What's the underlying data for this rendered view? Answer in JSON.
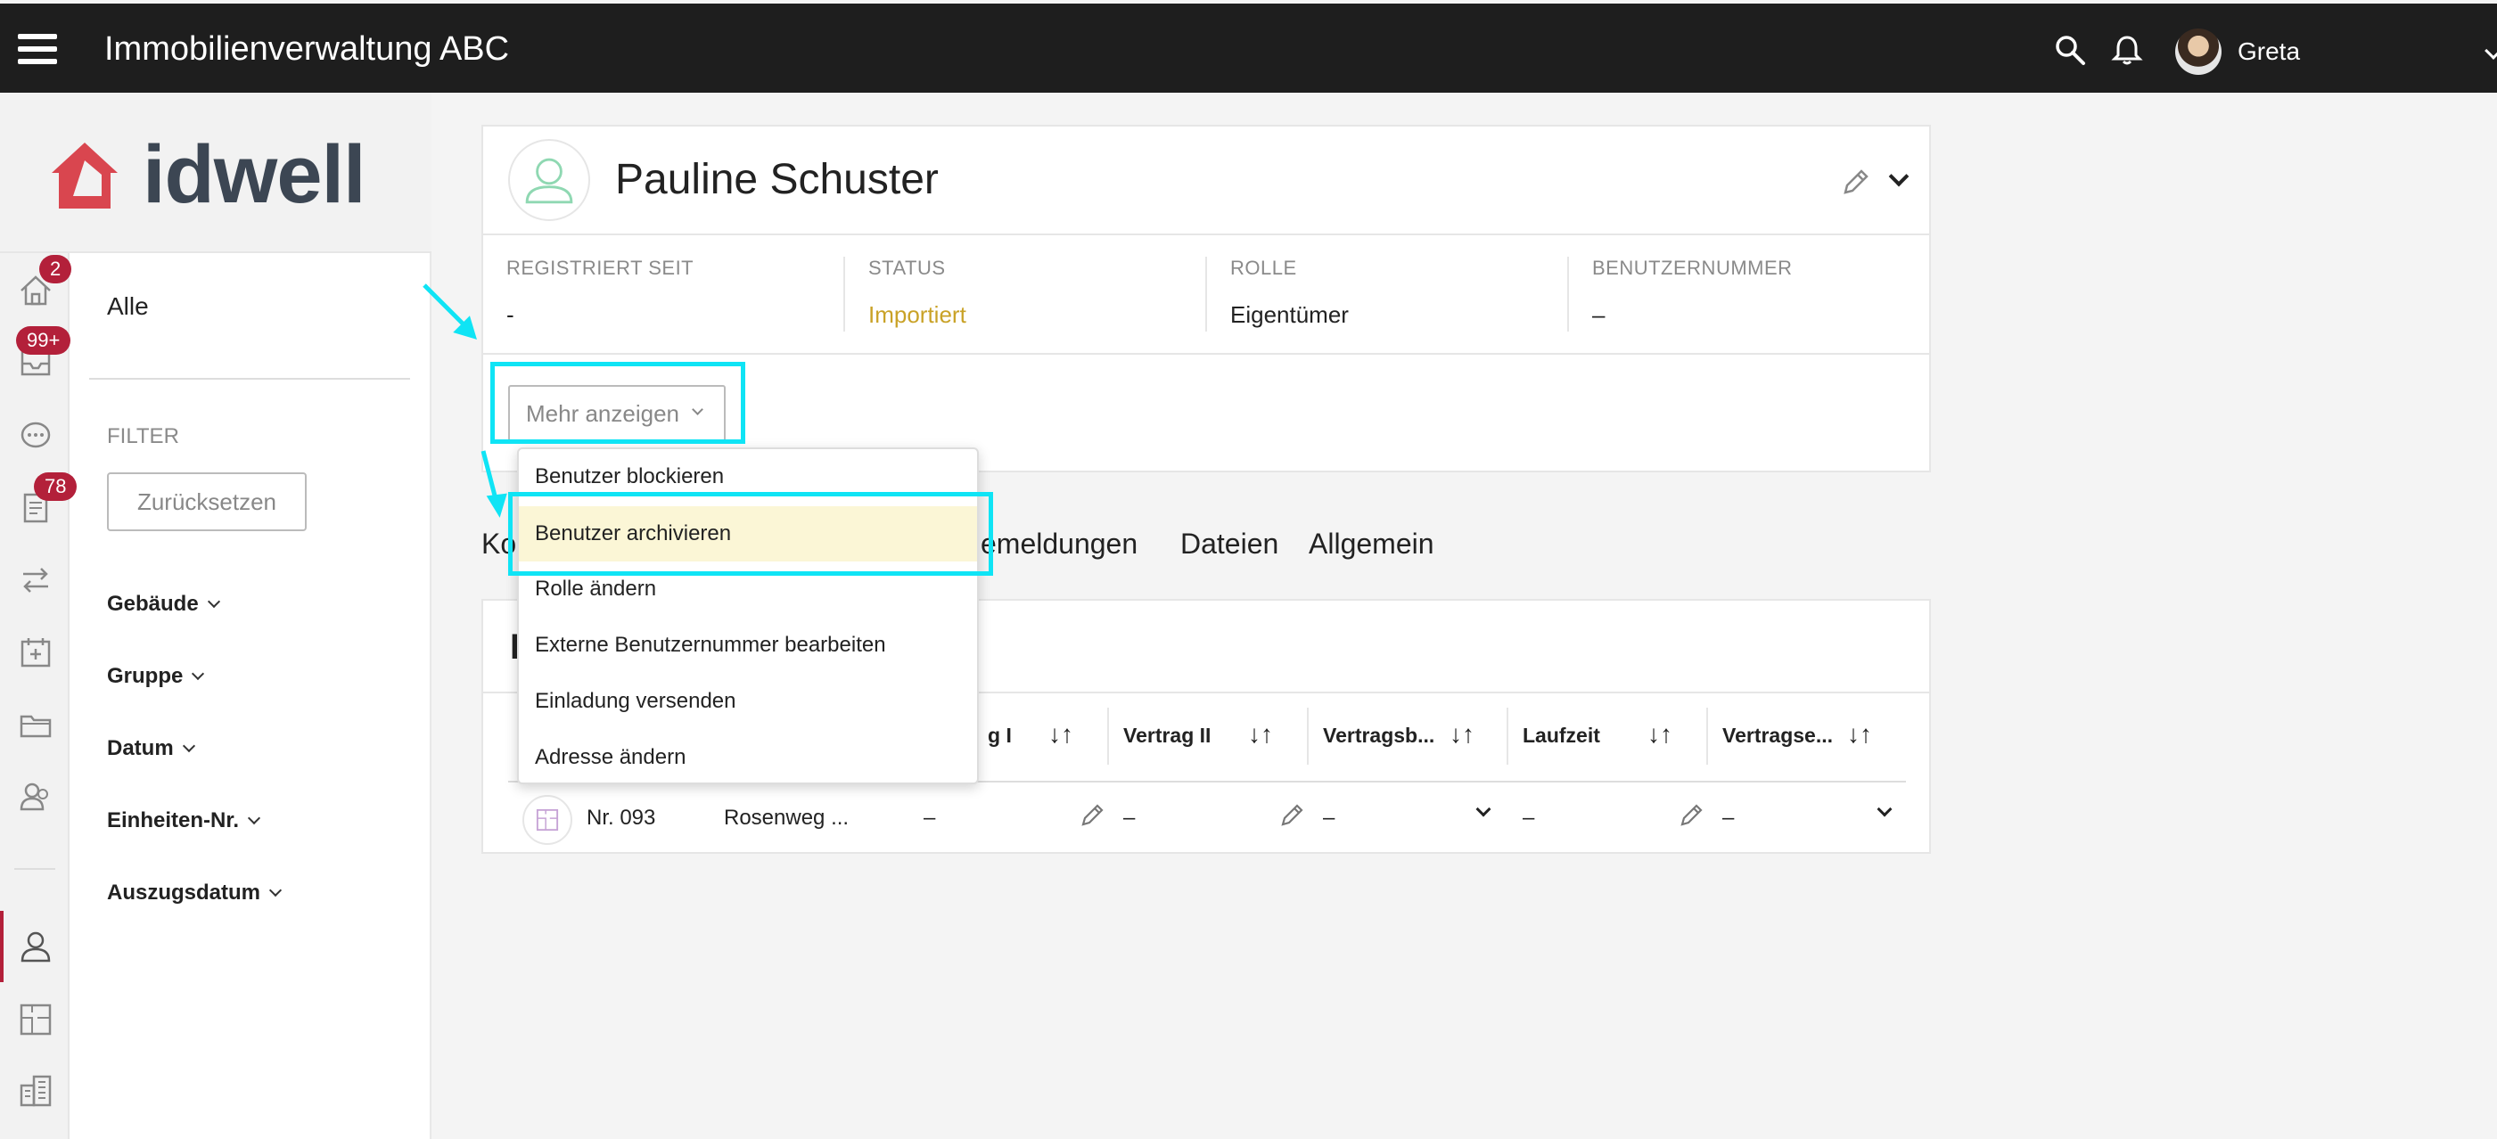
{
  "topbar": {
    "title": "Immobilienverwaltung ABC",
    "user_name": "Greta"
  },
  "sidebar": {
    "badges": {
      "home": "2",
      "inbox": "99+",
      "documents": "78"
    },
    "filter_all": "Alle",
    "filter_label": "FILTER",
    "reset_label": "Zurücksetzen",
    "categories": [
      "Gebäude",
      "Gruppe",
      "Datum",
      "Einheiten-Nr.",
      "Auszugsdatum"
    ]
  },
  "profile": {
    "name": "Pauline Schuster",
    "fields": [
      {
        "label": "REGISTRIERT SEIT",
        "value": "-"
      },
      {
        "label": "STATUS",
        "value": "Importiert"
      },
      {
        "label": "ROLLE",
        "value": "Eigentümer"
      },
      {
        "label": "BENUTZERNUMMER",
        "value": "–"
      }
    ],
    "more_button": "Mehr anzeigen"
  },
  "dropdown": {
    "items": [
      "Benutzer blockieren",
      "Benutzer archivieren",
      "Rolle ändern",
      "Externe Benutzernummer bearbeiten",
      "Einladung versenden",
      "Adresse ändern"
    ],
    "highlighted_index": 1
  },
  "tabs": [
    "Ko",
    "emeldungen",
    "Dateien",
    "Allgemein"
  ],
  "table": {
    "heading_partial": "E",
    "headers": [
      "g I",
      "Vertrag II",
      "Vertragsb...",
      "Laufzeit",
      "Vertragse..."
    ],
    "sort_glyph": "↓↑",
    "row": {
      "unit": "Nr. 093",
      "address": "Rosenweg ...",
      "dash": "–"
    }
  },
  "colors": {
    "status_importiert": "#c9a227",
    "badge": "#b3203a",
    "annotation": "#0fe4f5",
    "highlight": "#fbf6d6"
  }
}
